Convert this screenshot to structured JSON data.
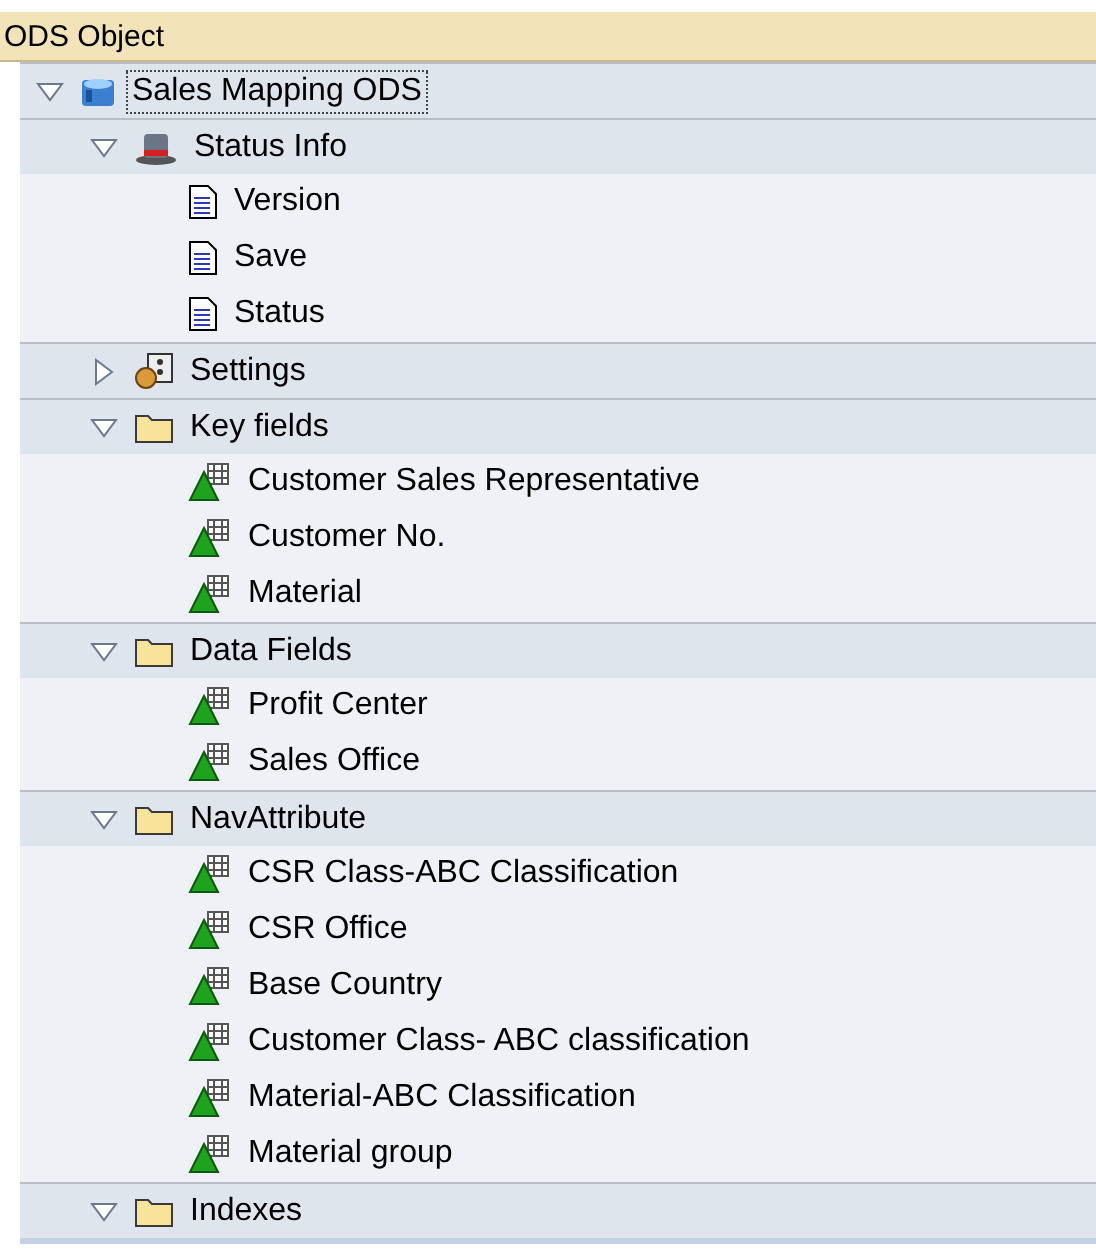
{
  "panel": {
    "title": "ODS Object"
  },
  "tree": [
    {
      "label": "Sales Mapping ODS",
      "kind": "database",
      "expanded": true,
      "focused": true,
      "children": [
        {
          "label": "Status Info",
          "kind": "hat",
          "expanded": true,
          "focused": false,
          "children": [
            {
              "label": "Version",
              "kind": "document"
            },
            {
              "label": "Save",
              "kind": "document"
            },
            {
              "label": "Status",
              "kind": "document"
            }
          ]
        },
        {
          "label": "Settings",
          "kind": "settings",
          "expanded": false,
          "focused": false
        },
        {
          "label": "Key fields",
          "kind": "folder",
          "expanded": true,
          "focused": false,
          "children": [
            {
              "label": "Customer Sales Representative",
              "kind": "characteristic"
            },
            {
              "label": "Customer No.",
              "kind": "characteristic"
            },
            {
              "label": "Material",
              "kind": "characteristic"
            }
          ]
        },
        {
          "label": "Data Fields",
          "kind": "folder",
          "expanded": true,
          "focused": false,
          "children": [
            {
              "label": "Profit Center",
              "kind": "characteristic"
            },
            {
              "label": "Sales Office",
              "kind": "characteristic"
            }
          ]
        },
        {
          "label": "NavAttribute",
          "kind": "folder",
          "expanded": true,
          "focused": false,
          "children": [
            {
              "label": "CSR Class-ABC Classification",
              "kind": "characteristic"
            },
            {
              "label": "CSR Office",
              "kind": "characteristic"
            },
            {
              "label": "Base Country",
              "kind": "characteristic"
            },
            {
              "label": "Customer Class- ABC classification",
              "kind": "characteristic"
            },
            {
              "label": "Material-ABC Classification",
              "kind": "characteristic"
            },
            {
              "label": "Material group",
              "kind": "characteristic"
            }
          ]
        },
        {
          "label": "Indexes",
          "kind": "folder",
          "expanded": true,
          "focused": false
        }
      ]
    }
  ]
}
